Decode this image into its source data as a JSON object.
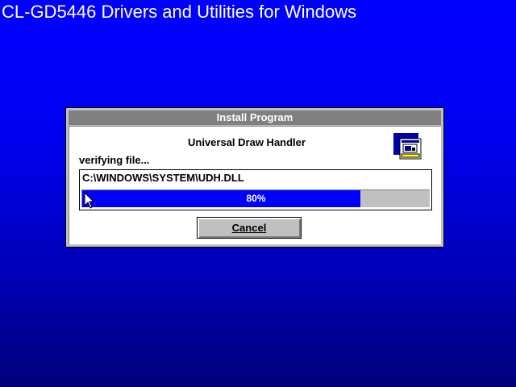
{
  "screen": {
    "title": "CL-GD5446 Drivers and Utilities for Windows",
    "background_color": "#0000ff"
  },
  "dialog": {
    "title": "Install Program",
    "program_name": "Universal Draw Handler",
    "status_label": "verifying file...",
    "file_path": "C:\\WINDOWS\\SYSTEM\\UDH.DLL",
    "progress": {
      "percent": 80,
      "text": "80%",
      "fill_color": "#0000ff",
      "track_color": "#c0c0c0"
    },
    "cancel_label": "Cancel",
    "icon": "setup-program-icon"
  },
  "cursor": {
    "icon": "arrow-cursor-icon"
  }
}
